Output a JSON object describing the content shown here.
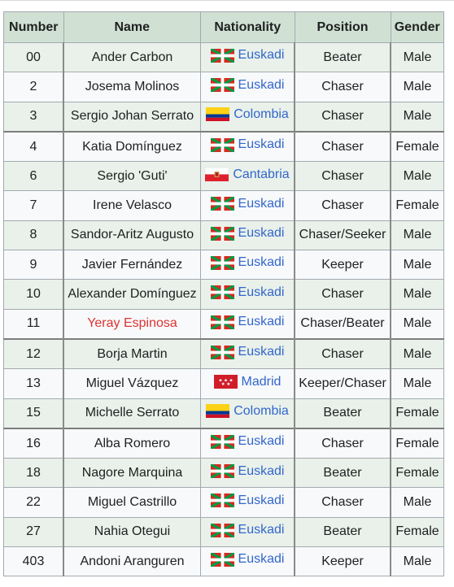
{
  "table": {
    "headers": [
      "Number",
      "Name",
      "Nationality",
      "Position",
      "Gender"
    ],
    "rows": [
      {
        "number": "00",
        "name": "Ander Carbon",
        "nationality": "Euskadi",
        "flag": "ikurrina-flag-icon",
        "position": "Beater",
        "gender": "Male",
        "group_start": false,
        "name_link": "normal"
      },
      {
        "number": "2",
        "name": "Josema Molinos",
        "nationality": "Euskadi",
        "flag": "ikurrina-flag-icon",
        "position": "Chaser",
        "gender": "Male",
        "group_start": false,
        "name_link": "normal"
      },
      {
        "number": "3",
        "name": "Sergio Johan Serrato",
        "nationality": "Colombia",
        "flag": "colombia-flag-icon",
        "position": "Chaser",
        "gender": "Male",
        "group_start": false,
        "name_link": "normal"
      },
      {
        "number": "4",
        "name": "Katia Domínguez",
        "nationality": "Euskadi",
        "flag": "ikurrina-flag-icon",
        "position": "Chaser",
        "gender": "Female",
        "group_start": true,
        "name_link": "normal"
      },
      {
        "number": "6",
        "name": "Sergio 'Guti'",
        "nationality": "Cantabria",
        "flag": "cantabria-flag-icon",
        "position": "Chaser",
        "gender": "Male",
        "group_start": false,
        "name_link": "normal"
      },
      {
        "number": "7",
        "name": "Irene Velasco",
        "nationality": "Euskadi",
        "flag": "ikurrina-flag-icon",
        "position": "Chaser",
        "gender": "Female",
        "group_start": false,
        "name_link": "normal"
      },
      {
        "number": "8",
        "name": "Sandor-Aritz Augusto",
        "nationality": "Euskadi",
        "flag": "ikurrina-flag-icon",
        "position": "Chaser/Seeker",
        "gender": "Male",
        "group_start": false,
        "name_link": "normal"
      },
      {
        "number": "9",
        "name": "Javier Fernández",
        "nationality": "Euskadi",
        "flag": "ikurrina-flag-icon",
        "position": "Keeper",
        "gender": "Male",
        "group_start": false,
        "name_link": "normal"
      },
      {
        "number": "10",
        "name": "Alexander Domínguez",
        "nationality": "Euskadi",
        "flag": "ikurrina-flag-icon",
        "position": "Chaser",
        "gender": "Male",
        "group_start": false,
        "name_link": "normal"
      },
      {
        "number": "11",
        "name": "Yeray Espinosa",
        "nationality": "Euskadi",
        "flag": "ikurrina-flag-icon",
        "position": "Chaser/Beater",
        "gender": "Male",
        "group_start": false,
        "name_link": "red"
      },
      {
        "number": "12",
        "name": "Borja Martin",
        "nationality": "Euskadi",
        "flag": "ikurrina-flag-icon",
        "position": "Chaser",
        "gender": "Male",
        "group_start": true,
        "name_link": "normal"
      },
      {
        "number": "13",
        "name": "Miguel Vázquez",
        "nationality": "Madrid",
        "flag": "madrid-flag-icon",
        "position": "Keeper/Chaser",
        "gender": "Male",
        "group_start": false,
        "name_link": "normal"
      },
      {
        "number": "15",
        "name": "Michelle Serrato",
        "nationality": "Colombia",
        "flag": "colombia-flag-icon",
        "position": "Beater",
        "gender": "Female",
        "group_start": false,
        "name_link": "normal"
      },
      {
        "number": "16",
        "name": "Alba Romero",
        "nationality": "Euskadi",
        "flag": "ikurrina-flag-icon",
        "position": "Chaser",
        "gender": "Female",
        "group_start": true,
        "name_link": "normal"
      },
      {
        "number": "18",
        "name": "Nagore Marquina",
        "nationality": "Euskadi",
        "flag": "ikurrina-flag-icon",
        "position": "Beater",
        "gender": "Female",
        "group_start": false,
        "name_link": "normal"
      },
      {
        "number": "22",
        "name": "Miguel Castrillo",
        "nationality": "Euskadi",
        "flag": "ikurrina-flag-icon",
        "position": "Chaser",
        "gender": "Male",
        "group_start": false,
        "name_link": "normal"
      },
      {
        "number": "27",
        "name": "Nahia Otegui",
        "nationality": "Euskadi",
        "flag": "ikurrina-flag-icon",
        "position": "Beater",
        "gender": "Female",
        "group_start": false,
        "name_link": "normal"
      },
      {
        "number": "403",
        "name": "Andoni Aranguren",
        "nationality": "Euskadi",
        "flag": "ikurrina-flag-icon",
        "position": "Keeper",
        "gender": "Male",
        "group_start": false,
        "name_link": "normal"
      }
    ]
  },
  "colors": {
    "header_bg": "#d0e1d3",
    "row_odd_bg": "#e9f1ea",
    "row_even_bg": "#f8f9fa",
    "link": "#3366cc",
    "redlink": "#d33333"
  }
}
